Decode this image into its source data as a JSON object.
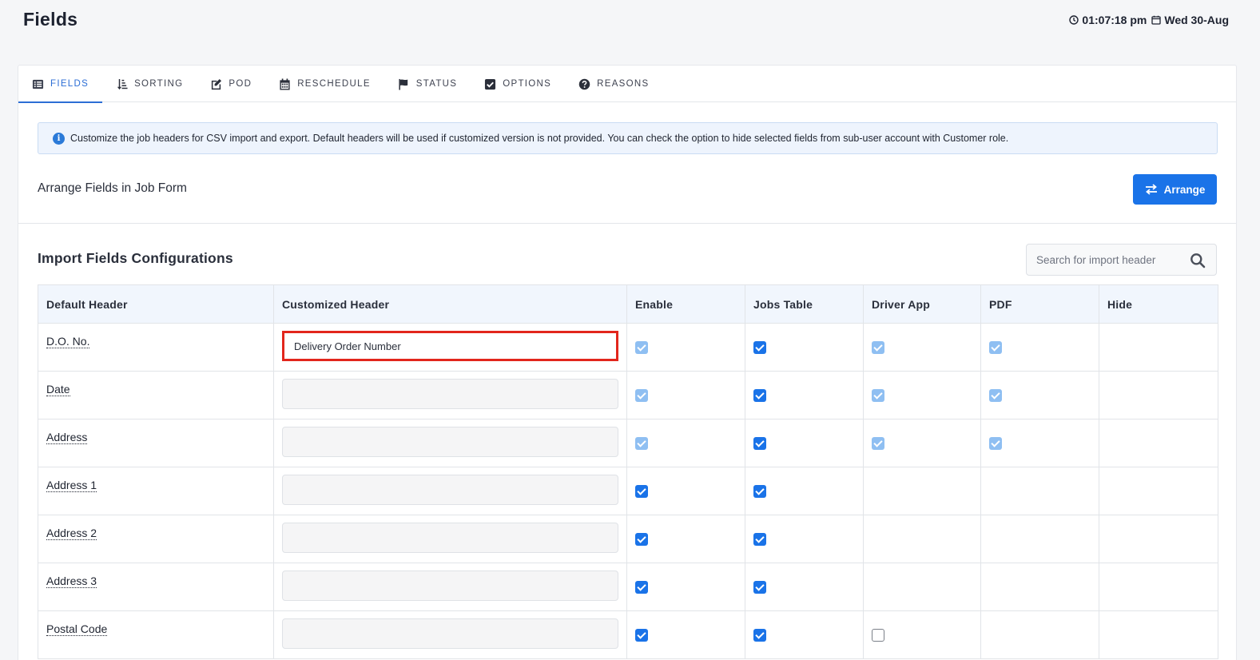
{
  "header": {
    "title": "Fields",
    "time": "01:07:18 pm",
    "date": "Wed 30-Aug"
  },
  "tabs": [
    {
      "label": "FIELDS",
      "icon": "list-icon"
    },
    {
      "label": "SORTING",
      "icon": "sort-icon"
    },
    {
      "label": "POD",
      "icon": "edit-icon"
    },
    {
      "label": "RESCHEDULE",
      "icon": "calendar-icon"
    },
    {
      "label": "STATUS",
      "icon": "flag-icon"
    },
    {
      "label": "OPTIONS",
      "icon": "check-square-icon"
    },
    {
      "label": "REASONS",
      "icon": "question-circle-icon"
    }
  ],
  "info": {
    "text": "Customize the job headers for CSV import and export. Default headers will be used if customized version is not provided. You can check the option to hide selected fields from sub-user account with Customer role."
  },
  "arrange": {
    "label": "Arrange Fields in Job Form",
    "button": "Arrange"
  },
  "import": {
    "title": "Import Fields Configurations",
    "search_placeholder": "Search for import header"
  },
  "table": {
    "headers": [
      "Default Header",
      "Customized Header",
      "Enable",
      "Jobs Table",
      "Driver App",
      "PDF",
      "Hide"
    ],
    "rows": [
      {
        "name": "D.O. No.",
        "custom": "Delivery Order Number",
        "enable": "dim",
        "jobs": "on",
        "driver": "dim",
        "pdf": "dim",
        "hide": "none"
      },
      {
        "name": "Date",
        "custom": "",
        "enable": "dim",
        "jobs": "on",
        "driver": "dim",
        "pdf": "dim",
        "hide": "none"
      },
      {
        "name": "Address",
        "custom": "",
        "enable": "dim",
        "jobs": "on",
        "driver": "dim",
        "pdf": "dim",
        "hide": "none"
      },
      {
        "name": "Address 1",
        "custom": "",
        "enable": "on",
        "jobs": "on",
        "driver": "none",
        "pdf": "none",
        "hide": "none"
      },
      {
        "name": "Address 2",
        "custom": "",
        "enable": "on",
        "jobs": "on",
        "driver": "none",
        "pdf": "none",
        "hide": "none"
      },
      {
        "name": "Address 3",
        "custom": "",
        "enable": "on",
        "jobs": "on",
        "driver": "none",
        "pdf": "none",
        "hide": "none"
      },
      {
        "name": "Postal Code",
        "custom": "",
        "enable": "on",
        "jobs": "on",
        "driver": "off",
        "pdf": "none",
        "hide": "none"
      }
    ]
  },
  "colors": {
    "accent": "#1a73e8",
    "highlight": "#e2261c"
  }
}
